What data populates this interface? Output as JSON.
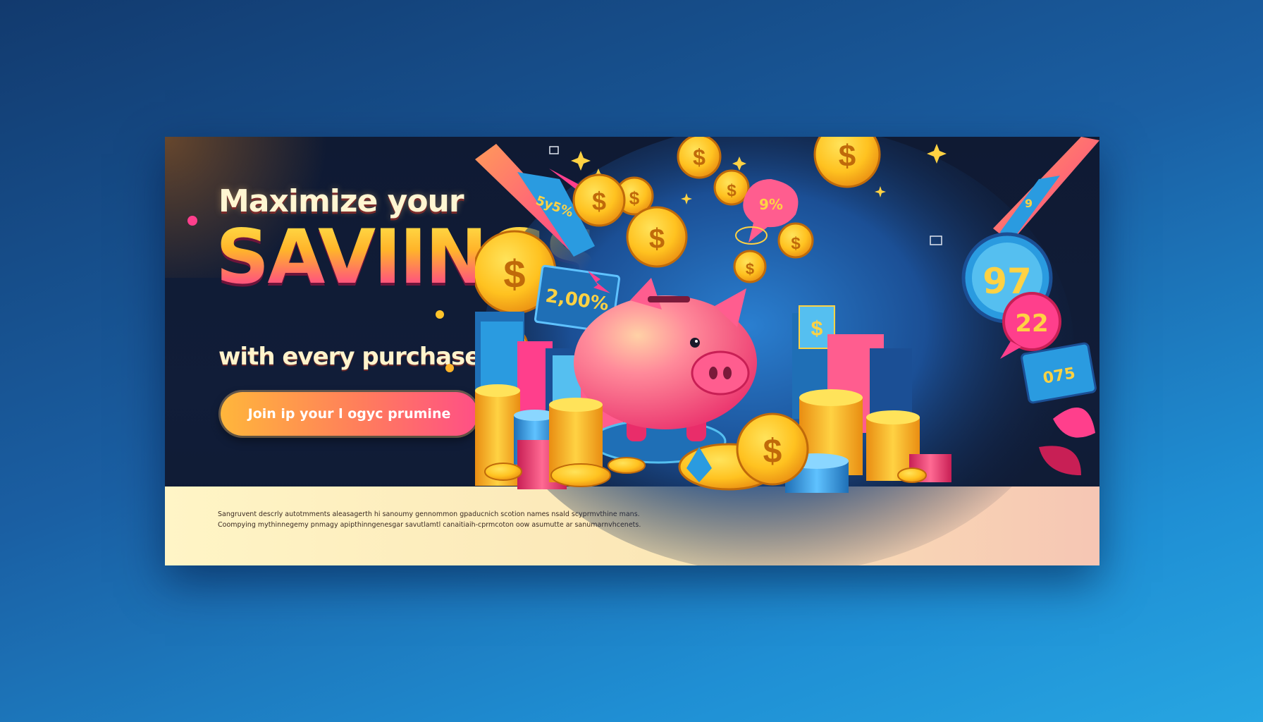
{
  "banner": {
    "headline": "Maximize your",
    "highlight": "SAVIINGS",
    "subheadline": "with every purchase",
    "cta_label": "Join ip your l ogyc prumine",
    "fine_print": [
      "Sangruvent descrly autotmments aleasagerth hi sanoumy gennommon gpaducnich scotion names nsald scyprmvthine mans.",
      "Coompying mythinnegemy pnmagy apipthinngenesgar savutlamtl canaitiaih-cprmcoton oow asumutte ar sanumarnvhcenets."
    ],
    "badges": {
      "percent_sign": "2,00%",
      "round_top": "97",
      "round_bottom": "22",
      "bubble_percent": "9%",
      "arrow_left_text": "5y5%",
      "arrow_right_text": "9",
      "card_small": "075",
      "card_dollar": "$"
    },
    "colors": {
      "background_dark": "#0f1a33",
      "cream": "#fff5c6",
      "gold": "#ffc42a",
      "pink": "#ff3f8c",
      "blue": "#2a9be0"
    }
  }
}
